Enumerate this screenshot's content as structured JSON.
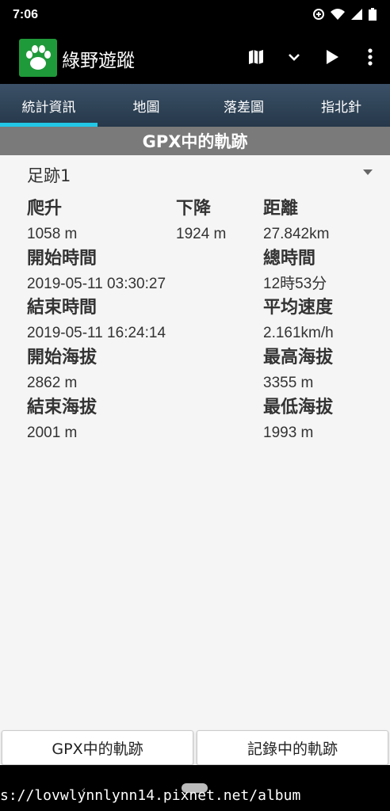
{
  "status_bar": {
    "time": "7:06"
  },
  "app_bar": {
    "title": "綠野遊蹤"
  },
  "tabs": [
    {
      "label": "統計資訊",
      "active": true
    },
    {
      "label": "地圖",
      "active": false
    },
    {
      "label": "落差圖",
      "active": false
    },
    {
      "label": "指北針",
      "active": false
    }
  ],
  "section_title": "GPX中的軌跡",
  "track_selector": {
    "value": "足跡1"
  },
  "stats": {
    "ascent": {
      "label": "爬升",
      "value": "1058 m"
    },
    "descent": {
      "label": "下降",
      "value": "1924 m"
    },
    "distance": {
      "label": "距離",
      "value": "27.842km"
    },
    "start_time": {
      "label": "開始時間",
      "value": "2019-05-11 03:30:27"
    },
    "total_time": {
      "label": "總時間",
      "value": "12時53分"
    },
    "end_time": {
      "label": "結束時間",
      "value": "2019-05-11 16:24:14"
    },
    "avg_speed": {
      "label": "平均速度",
      "value": "2.161km/h"
    },
    "start_elevation": {
      "label": "開始海拔",
      "value": "2862 m"
    },
    "max_elevation": {
      "label": "最高海拔",
      "value": "3355 m"
    },
    "end_elevation": {
      "label": "結束海拔",
      "value": "2001 m"
    },
    "min_elevation": {
      "label": "最低海拔",
      "value": "1993 m"
    }
  },
  "bottom_buttons": {
    "gpx_track": "GPX中的軌跡",
    "recording_track": "記錄中的軌跡"
  },
  "watermark": "s://lovwlynnlynn14.pixnet.net/album",
  "colors": {
    "active_tab_indicator": "#22c7e6",
    "logo_green": "#1f9a3a",
    "section_bar": "#7a7a7a"
  }
}
